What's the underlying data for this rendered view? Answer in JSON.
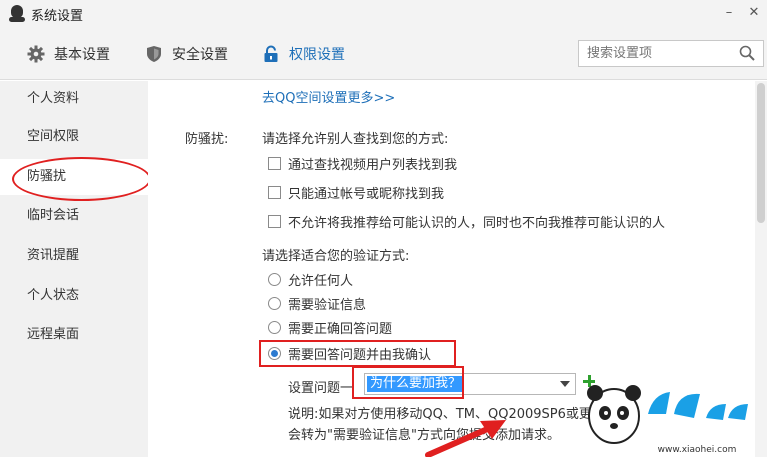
{
  "window": {
    "title": "系统设置",
    "minimize_glyph": "–",
    "close_glyph": "✕"
  },
  "tabs": [
    {
      "label": "基本设置",
      "icon": "gear-icon"
    },
    {
      "label": "安全设置",
      "icon": "shield-icon"
    },
    {
      "label": "权限设置",
      "icon": "lock-icon",
      "active": true
    }
  ],
  "search": {
    "placeholder": "搜索设置项",
    "icon": "search-icon"
  },
  "sidebar": {
    "items": [
      {
        "label": "个人资料"
      },
      {
        "label": "空间权限"
      },
      {
        "label": "防骚扰",
        "active": true
      },
      {
        "label": "临时会话"
      },
      {
        "label": "资讯提醒"
      },
      {
        "label": "个人状态"
      },
      {
        "label": "远程桌面"
      }
    ]
  },
  "main": {
    "more_link": "去QQ空间设置更多>>",
    "section_label": "防骚扰:",
    "find_prompt": "请选择允许别人查找到您的方式:",
    "find_options": [
      {
        "label": "通过查找视频用户列表找到我",
        "checked": false
      },
      {
        "label": "只能通过帐号或昵称找到我",
        "checked": false
      },
      {
        "label": "不允许将我推荐给可能认识的人，同时也不向我推荐可能认识的人",
        "checked": false
      }
    ],
    "verify_prompt": "请选择适合您的验证方式:",
    "verify_options": [
      {
        "label": "允许任何人",
        "checked": false
      },
      {
        "label": "需要验证信息",
        "checked": false
      },
      {
        "label": "需要正确回答问题",
        "checked": false
      },
      {
        "label": "需要回答问题并由我确认",
        "checked": true
      }
    ],
    "question_label": "设置问题一",
    "question_value": "为什么要加我？",
    "note_line1": "说明:如果对方使用移动QQ、TM、QQ2009SP6或更早",
    "note_line2": "会转为\"需要验证信息\"方式向您提交添加请求。"
  },
  "watermark": {
    "text": "小黑游戏",
    "url_text": "www.xiaohei.com"
  },
  "colors": {
    "accent": "#1e6fb8",
    "highlight": "#e02020",
    "selection": "#3399ff",
    "add": "#2ea02e"
  }
}
